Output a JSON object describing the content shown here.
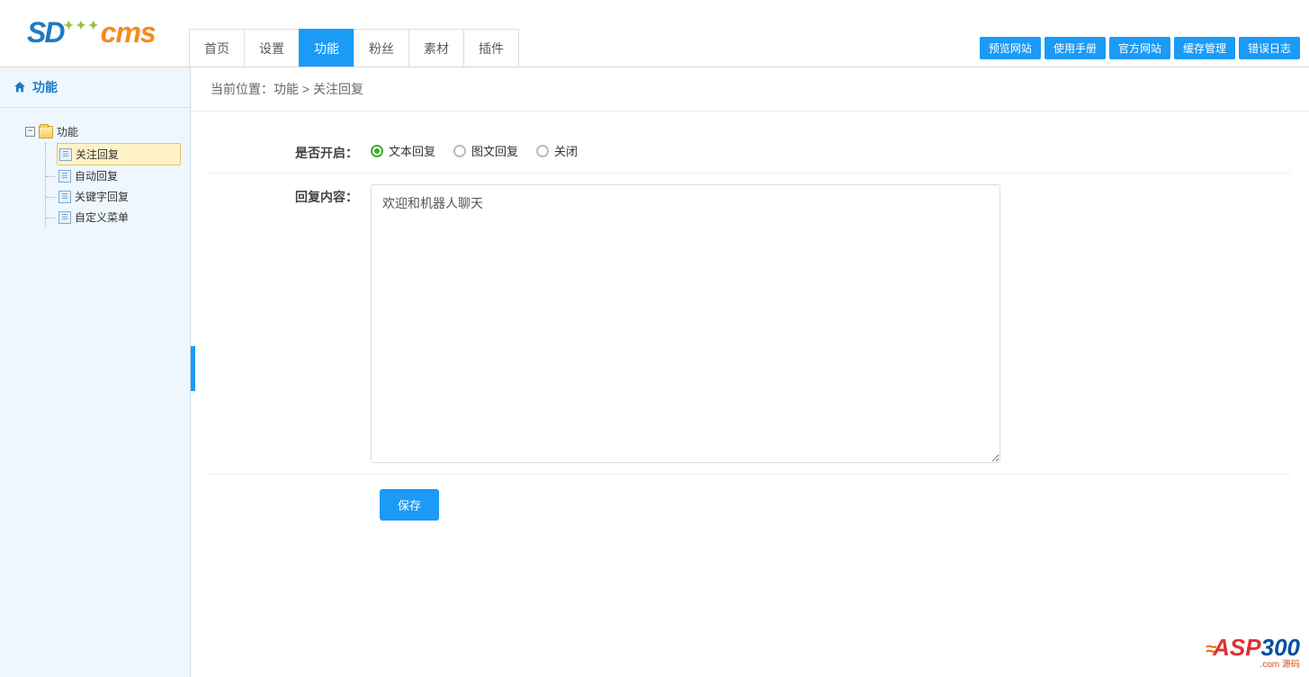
{
  "logo": {
    "part1": "SD",
    "part2": "cms"
  },
  "topnav": {
    "items": [
      {
        "label": "首页"
      },
      {
        "label": "设置"
      },
      {
        "label": "功能"
      },
      {
        "label": "粉丝"
      },
      {
        "label": "素材"
      },
      {
        "label": "插件"
      }
    ]
  },
  "toplinks": {
    "items": [
      {
        "label": "预览网站"
      },
      {
        "label": "使用手册"
      },
      {
        "label": "官方网站"
      },
      {
        "label": "缓存管理"
      },
      {
        "label": "错误日志"
      }
    ]
  },
  "sidebar": {
    "title": "功能",
    "tree_root": "功能",
    "expand_symbol": "−",
    "items": [
      {
        "label": "关注回复"
      },
      {
        "label": "自动回复"
      },
      {
        "label": "关键字回复"
      },
      {
        "label": "自定义菜单"
      }
    ]
  },
  "breadcrumb": {
    "prefix": "当前位置：",
    "sep": " > ",
    "parts": [
      "功能",
      "关注回复"
    ]
  },
  "form": {
    "enable_label": "是否开启：",
    "enable_options": [
      {
        "label": "文本回复",
        "checked": true
      },
      {
        "label": "图文回复",
        "checked": false
      },
      {
        "label": "关闭",
        "checked": false
      }
    ],
    "content_label": "回复内容：",
    "content_value": "欢迎和机器人聊天",
    "save_label": "保存"
  },
  "watermark": {
    "text1": "ASP",
    "text2": "300",
    "sub": ".com 源码"
  }
}
